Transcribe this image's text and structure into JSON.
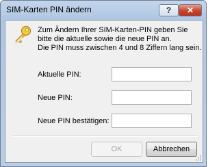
{
  "window": {
    "title": "SIM-Karten PIN ändern",
    "help_label": "?",
    "close_label": "✕"
  },
  "message": {
    "lines": [
      "Zum Ändern Ihrer SIM-Karten-PIN geben Sie",
      "bitte die aktuelle sowie die neue PIN an.",
      "Die PIN muss zwischen 4 und 8 Ziffern lang sein."
    ]
  },
  "form": {
    "current_pin_label": "Aktuelle PIN:",
    "current_pin_value": "",
    "new_pin_label": "Neue PIN:",
    "new_pin_value": "",
    "confirm_pin_label": "Neue PIN bestätigen:",
    "confirm_pin_value": ""
  },
  "buttons": {
    "ok_label": "OK",
    "cancel_label": "Abbrechen"
  },
  "icons": {
    "dialog_icon": "key-icon",
    "resize": "resize-grip-icon"
  }
}
